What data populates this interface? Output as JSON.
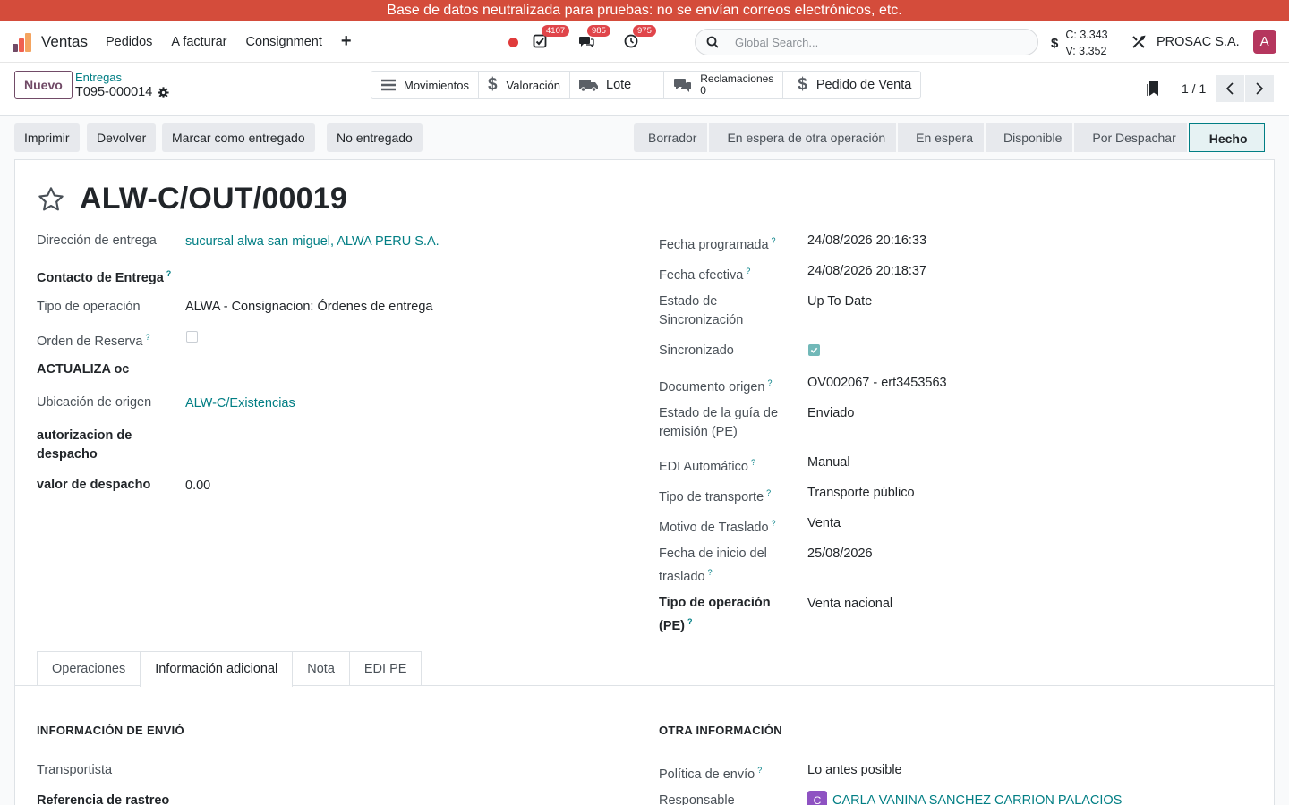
{
  "banner": "Base de datos neutralizada para pruebas: no se envían correos electrónicos, etc.",
  "nav": {
    "app_name": "Ventas",
    "menus": [
      "Pedidos",
      "A facturar",
      "Consignment"
    ],
    "badges": {
      "activities": "4107",
      "messages": "985",
      "clock": "975"
    },
    "search_placeholder": "Global Search...",
    "rate_c": "C: 3.343",
    "rate_v": "V: 3.352",
    "company": "PROSAC S.A.",
    "avatar_letter": "A"
  },
  "control": {
    "new_label": "Nuevo",
    "breadcrumb_parent": "Entregas",
    "breadcrumb_current": "T095-000014",
    "smart": {
      "movimientos": "Movimientos",
      "valoracion": "Valoración",
      "lote": "Lote",
      "reclamaciones": "Reclamaciones",
      "reclamaciones_count": "0",
      "pedido": "Pedido de Venta"
    },
    "pager": "1 / 1"
  },
  "actions": [
    "Imprimir",
    "Devolver",
    "Marcar como entregado",
    "No entregado"
  ],
  "stages": [
    "Borrador",
    "En espera de otra operación",
    "En espera",
    "Disponible",
    "Por Despachar",
    "Hecho"
  ],
  "record": {
    "title": "ALW-C/OUT/00019",
    "left": {
      "direccion_label": "Dirección de entrega",
      "direccion_value": "sucursal alwa san miguel, ALWA PERU S.A.",
      "contacto_label": "Contacto de Entrega",
      "tipo_label": "Tipo de operación",
      "tipo_value": "ALWA - Consignacion: Órdenes de entrega",
      "reserva_label": "Orden de Reserva",
      "actualiza_label": "ACTUALIZA oc",
      "ubicacion_label": "Ubicación de origen",
      "ubicacion_value": "ALW-C/Existencias",
      "autorizacion_label": "autorizacion de despacho",
      "valor_label": "valor de despacho",
      "valor_value": "0.00"
    },
    "right": {
      "fecha_prog_label": "Fecha programada",
      "fecha_prog_value": "24/08/2026 20:16:33",
      "fecha_efec_label": "Fecha efectiva",
      "fecha_efec_value": "24/08/2026 20:18:37",
      "estado_sync_label": "Estado de Sincronización",
      "estado_sync_value": "Up To Date",
      "sincronizado_label": "Sincronizado",
      "doc_origen_label": "Documento origen",
      "doc_origen_value": "OV002067 - ert3453563",
      "estado_guia_label": "Estado de la guía de remisión (PE)",
      "estado_guia_value": "Enviado",
      "edi_label": "EDI Automático",
      "edi_value": "Manual",
      "transporte_label": "Tipo de transporte",
      "transporte_value": "Transporte público",
      "motivo_label": "Motivo de Traslado",
      "motivo_value": "Venta",
      "fecha_inicio_label": "Fecha de inicio del traslado",
      "fecha_inicio_value": "25/08/2026",
      "tipo_op_pe_label": "Tipo de operación (PE)",
      "tipo_op_pe_value": "Venta nacional"
    }
  },
  "tabs": [
    "Operaciones",
    "Información adicional",
    "Nota",
    "EDI PE"
  ],
  "info": {
    "envio_title": "INFORMACIÓN DE ENVIÓ",
    "otra_title": "OTRA INFORMACIÓN",
    "transportista_label": "Transportista",
    "rastreo_label": "Referencia de rastreo",
    "politica_label": "Política de envío",
    "politica_value": "Lo antes posible",
    "responsable_label": "Responsable",
    "responsable_initial": "C",
    "responsable_value": "CARLA VANINA SANCHEZ CARRION PALACIOS"
  },
  "colors": {
    "banner": "#d44c3b",
    "link": "#017e84",
    "brand": "#714b67"
  }
}
